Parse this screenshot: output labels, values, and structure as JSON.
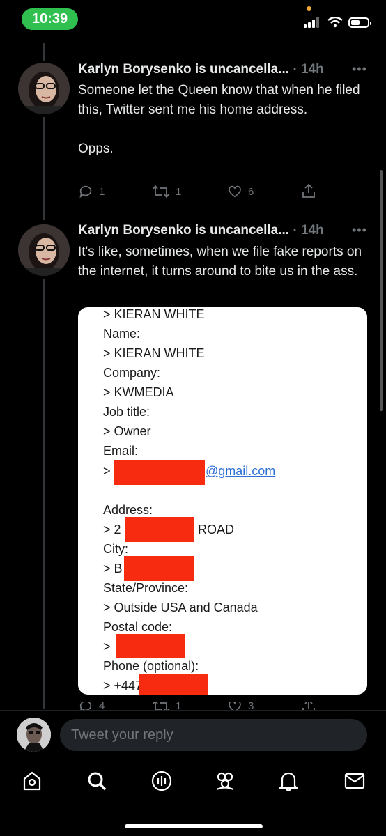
{
  "status_bar": {
    "time": "10:39"
  },
  "tweets": [
    {
      "author": "Karlyn Borysenko is uncancella...",
      "time": "14h",
      "text": "Someone let the Queen know that when he filed this, Twitter sent me his home address.\n\nOpps.",
      "replies": "1",
      "retweets": "1",
      "likes": "6"
    },
    {
      "author": "Karlyn Borysenko is uncancella...",
      "time": "14h",
      "text": "It's like, sometimes, when we file fake reports on the internet, it turns around to bite us in the ass.",
      "replies": "4",
      "retweets": "1",
      "likes": "3"
    }
  ],
  "document": {
    "lines": [
      "> KIERAN WHITE",
      "Name:",
      "> KIERAN WHITE",
      "Company:",
      "> KWMEDIA",
      "Job title:",
      "> Owner",
      "Email:",
      "Address:",
      "City:",
      "State/Province:",
      "> Outside USA and Canada",
      "Postal code:",
      "Phone (optional):"
    ],
    "email_prefix": ">",
    "email_domain": "@gmail.com",
    "address_prefix": "> 2",
    "address_suffix": "ROAD",
    "city_prefix": "> B",
    "postal_prefix": ">",
    "phone_prefix": "> +447"
  },
  "reply": {
    "placeholder": "Tweet your reply"
  },
  "nav": [
    "home-icon",
    "search-icon",
    "spaces-icon",
    "communities-icon",
    "notifications-icon",
    "messages-icon"
  ],
  "colors": {
    "accent_green": "#30c04f",
    "redaction": "#f62b0f",
    "link": "#2f6fd6"
  }
}
